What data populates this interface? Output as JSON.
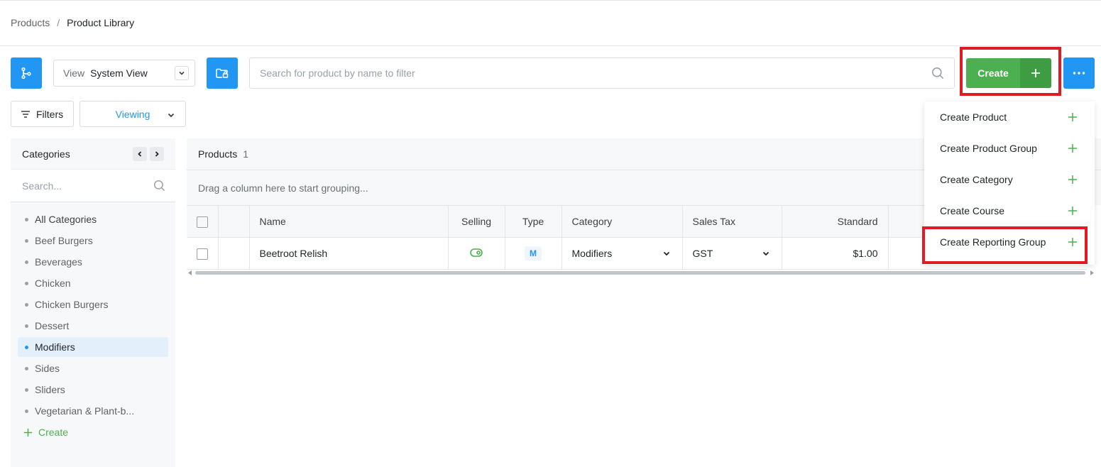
{
  "breadcrumb": {
    "parent": "Products",
    "separator": "/",
    "current": "Product Library"
  },
  "toolbar": {
    "view_label": "View",
    "view_value": "System View",
    "search_placeholder": "Search for product by name to filter",
    "create_label": "Create",
    "filters_label": "Filters",
    "viewing_label": "Viewing"
  },
  "categories": {
    "title": "Categories",
    "search_placeholder": "Search...",
    "items": [
      {
        "label": "All Categories"
      },
      {
        "label": "Beef Burgers"
      },
      {
        "label": "Beverages"
      },
      {
        "label": "Chicken"
      },
      {
        "label": "Chicken Burgers"
      },
      {
        "label": "Dessert"
      },
      {
        "label": "Modifiers"
      },
      {
        "label": "Sides"
      },
      {
        "label": "Sliders"
      },
      {
        "label": "Vegetarian & Plant-b..."
      }
    ],
    "active_item": "Modifiers",
    "create_label": "Create"
  },
  "products": {
    "title": "Products",
    "count": "1",
    "group_hint": "Drag a column here to start grouping...",
    "columns": [
      "Name",
      "Selling",
      "Type",
      "Category",
      "Sales Tax",
      "Standard"
    ],
    "rows": [
      {
        "name": "Beetroot Relish",
        "type": "M",
        "category": "Modifiers",
        "sales_tax": "GST",
        "standard": "$1.00"
      }
    ]
  },
  "create_menu": {
    "items": [
      {
        "label": "Create Product"
      },
      {
        "label": "Create Product Group"
      },
      {
        "label": "Create Category"
      },
      {
        "label": "Create Course"
      },
      {
        "label": "Create Reporting Group"
      }
    ],
    "highlighted_item": "Create Reporting Group"
  },
  "colors": {
    "primary_blue": "#2196f3",
    "create_green": "#4caf50",
    "highlight_red": "#e01b24"
  },
  "icons": [
    "branch-icon",
    "chevron-down-icon",
    "folder-lock-icon",
    "search-icon",
    "plus-icon",
    "more-horizontal-icon",
    "filter-lines-icon",
    "chevron-left-icon",
    "chevron-right-icon",
    "toggle-on-icon"
  ]
}
